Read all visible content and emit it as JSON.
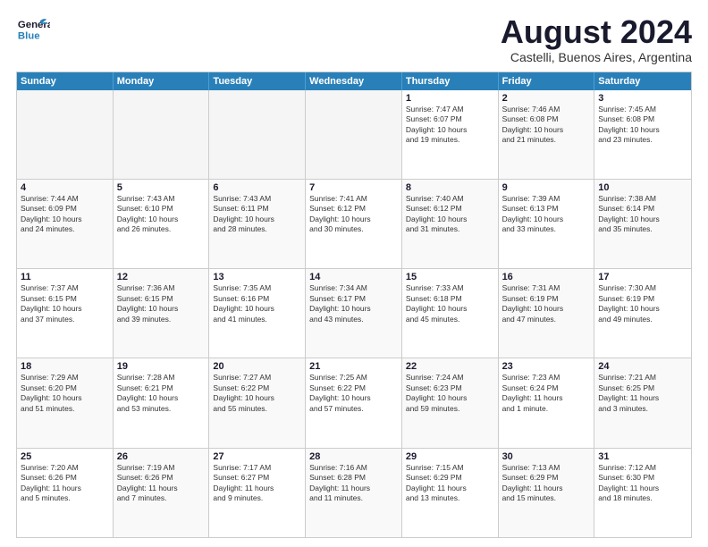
{
  "header": {
    "logo_general": "General",
    "logo_blue": "Blue",
    "month_title": "August 2024",
    "location": "Castelli, Buenos Aires, Argentina"
  },
  "weekdays": [
    "Sunday",
    "Monday",
    "Tuesday",
    "Wednesday",
    "Thursday",
    "Friday",
    "Saturday"
  ],
  "rows": [
    [
      {
        "day": "",
        "info": "",
        "empty": true
      },
      {
        "day": "",
        "info": "",
        "empty": true
      },
      {
        "day": "",
        "info": "",
        "empty": true
      },
      {
        "day": "",
        "info": "",
        "empty": true
      },
      {
        "day": "1",
        "info": "Sunrise: 7:47 AM\nSunset: 6:07 PM\nDaylight: 10 hours\nand 19 minutes."
      },
      {
        "day": "2",
        "info": "Sunrise: 7:46 AM\nSunset: 6:08 PM\nDaylight: 10 hours\nand 21 minutes."
      },
      {
        "day": "3",
        "info": "Sunrise: 7:45 AM\nSunset: 6:08 PM\nDaylight: 10 hours\nand 23 minutes."
      }
    ],
    [
      {
        "day": "4",
        "info": "Sunrise: 7:44 AM\nSunset: 6:09 PM\nDaylight: 10 hours\nand 24 minutes."
      },
      {
        "day": "5",
        "info": "Sunrise: 7:43 AM\nSunset: 6:10 PM\nDaylight: 10 hours\nand 26 minutes."
      },
      {
        "day": "6",
        "info": "Sunrise: 7:43 AM\nSunset: 6:11 PM\nDaylight: 10 hours\nand 28 minutes."
      },
      {
        "day": "7",
        "info": "Sunrise: 7:41 AM\nSunset: 6:12 PM\nDaylight: 10 hours\nand 30 minutes."
      },
      {
        "day": "8",
        "info": "Sunrise: 7:40 AM\nSunset: 6:12 PM\nDaylight: 10 hours\nand 31 minutes."
      },
      {
        "day": "9",
        "info": "Sunrise: 7:39 AM\nSunset: 6:13 PM\nDaylight: 10 hours\nand 33 minutes."
      },
      {
        "day": "10",
        "info": "Sunrise: 7:38 AM\nSunset: 6:14 PM\nDaylight: 10 hours\nand 35 minutes."
      }
    ],
    [
      {
        "day": "11",
        "info": "Sunrise: 7:37 AM\nSunset: 6:15 PM\nDaylight: 10 hours\nand 37 minutes."
      },
      {
        "day": "12",
        "info": "Sunrise: 7:36 AM\nSunset: 6:15 PM\nDaylight: 10 hours\nand 39 minutes."
      },
      {
        "day": "13",
        "info": "Sunrise: 7:35 AM\nSunset: 6:16 PM\nDaylight: 10 hours\nand 41 minutes."
      },
      {
        "day": "14",
        "info": "Sunrise: 7:34 AM\nSunset: 6:17 PM\nDaylight: 10 hours\nand 43 minutes."
      },
      {
        "day": "15",
        "info": "Sunrise: 7:33 AM\nSunset: 6:18 PM\nDaylight: 10 hours\nand 45 minutes."
      },
      {
        "day": "16",
        "info": "Sunrise: 7:31 AM\nSunset: 6:19 PM\nDaylight: 10 hours\nand 47 minutes."
      },
      {
        "day": "17",
        "info": "Sunrise: 7:30 AM\nSunset: 6:19 PM\nDaylight: 10 hours\nand 49 minutes."
      }
    ],
    [
      {
        "day": "18",
        "info": "Sunrise: 7:29 AM\nSunset: 6:20 PM\nDaylight: 10 hours\nand 51 minutes."
      },
      {
        "day": "19",
        "info": "Sunrise: 7:28 AM\nSunset: 6:21 PM\nDaylight: 10 hours\nand 53 minutes."
      },
      {
        "day": "20",
        "info": "Sunrise: 7:27 AM\nSunset: 6:22 PM\nDaylight: 10 hours\nand 55 minutes."
      },
      {
        "day": "21",
        "info": "Sunrise: 7:25 AM\nSunset: 6:22 PM\nDaylight: 10 hours\nand 57 minutes."
      },
      {
        "day": "22",
        "info": "Sunrise: 7:24 AM\nSunset: 6:23 PM\nDaylight: 10 hours\nand 59 minutes."
      },
      {
        "day": "23",
        "info": "Sunrise: 7:23 AM\nSunset: 6:24 PM\nDaylight: 11 hours\nand 1 minute."
      },
      {
        "day": "24",
        "info": "Sunrise: 7:21 AM\nSunset: 6:25 PM\nDaylight: 11 hours\nand 3 minutes."
      }
    ],
    [
      {
        "day": "25",
        "info": "Sunrise: 7:20 AM\nSunset: 6:26 PM\nDaylight: 11 hours\nand 5 minutes."
      },
      {
        "day": "26",
        "info": "Sunrise: 7:19 AM\nSunset: 6:26 PM\nDaylight: 11 hours\nand 7 minutes."
      },
      {
        "day": "27",
        "info": "Sunrise: 7:17 AM\nSunset: 6:27 PM\nDaylight: 11 hours\nand 9 minutes."
      },
      {
        "day": "28",
        "info": "Sunrise: 7:16 AM\nSunset: 6:28 PM\nDaylight: 11 hours\nand 11 minutes."
      },
      {
        "day": "29",
        "info": "Sunrise: 7:15 AM\nSunset: 6:29 PM\nDaylight: 11 hours\nand 13 minutes."
      },
      {
        "day": "30",
        "info": "Sunrise: 7:13 AM\nSunset: 6:29 PM\nDaylight: 11 hours\nand 15 minutes."
      },
      {
        "day": "31",
        "info": "Sunrise: 7:12 AM\nSunset: 6:30 PM\nDaylight: 11 hours\nand 18 minutes."
      }
    ]
  ]
}
